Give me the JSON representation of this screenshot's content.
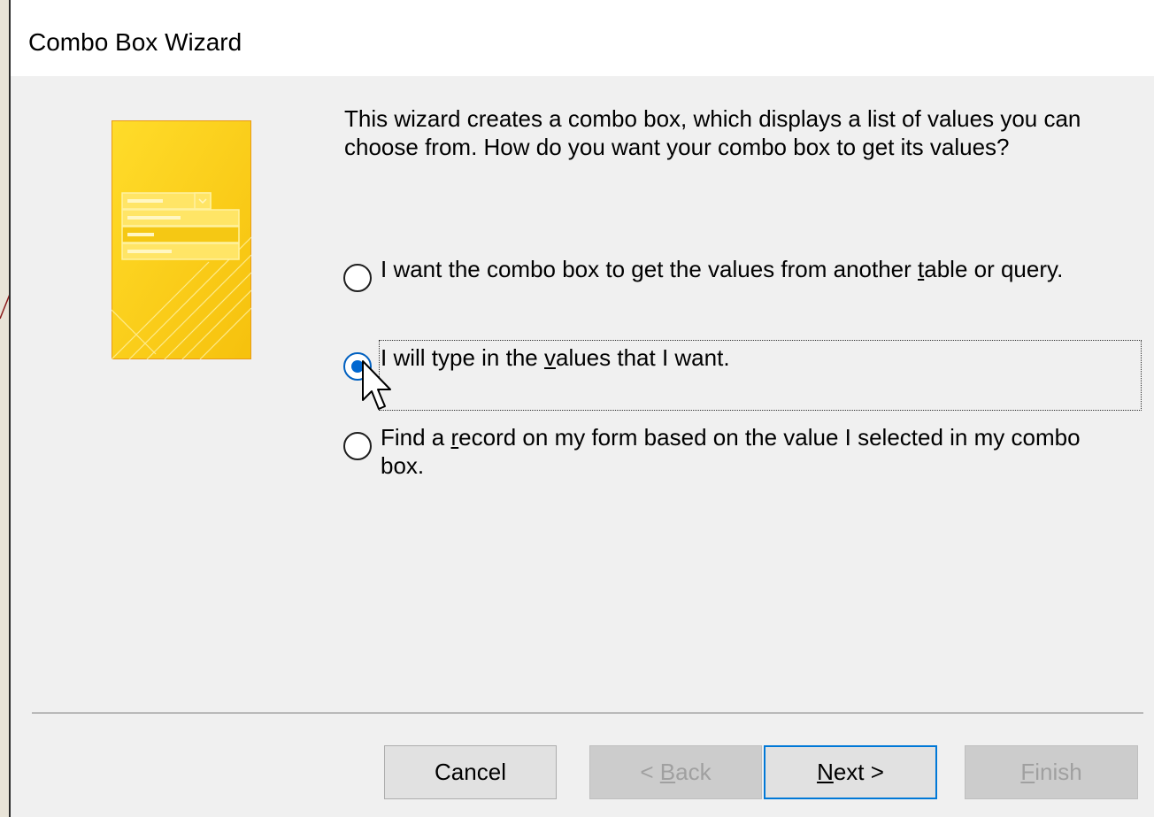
{
  "window": {
    "title": "Combo Box Wizard"
  },
  "illustration": {
    "icon": "combo-box-wizard-illustration",
    "colors": {
      "gold": "#ffd21e",
      "gold_dark": "#f2b705",
      "border": "#e89a17"
    }
  },
  "prompt": {
    "text": "This wizard creates a combo box, which displays a list of values you can choose from.  How do you want your combo box to get its values?"
  },
  "options": [
    {
      "before": "I want the combo box to get the values from another ",
      "key": "t",
      "after": "able or query.",
      "checked": false
    },
    {
      "before": "I will type in the ",
      "key": "v",
      "after": "alues that I want.",
      "checked": true
    },
    {
      "before": "Find a ",
      "key": "r",
      "after": "ecord on my form based on the value I selected in my combo box.",
      "checked": false
    }
  ],
  "buttons": {
    "cancel": {
      "label": "Cancel",
      "enabled": true
    },
    "back": {
      "pre": "< ",
      "key": "B",
      "post": "ack",
      "enabled": false
    },
    "next": {
      "pre": "",
      "key": "N",
      "post": "ext >",
      "enabled": true,
      "default": true
    },
    "finish": {
      "pre": "",
      "key": "F",
      "post": "inish",
      "enabled": false
    }
  },
  "colors": {
    "radio_selected": "#0067d0",
    "default_button_border": "#0078d7",
    "dialog_background": "#f0f0f0"
  }
}
